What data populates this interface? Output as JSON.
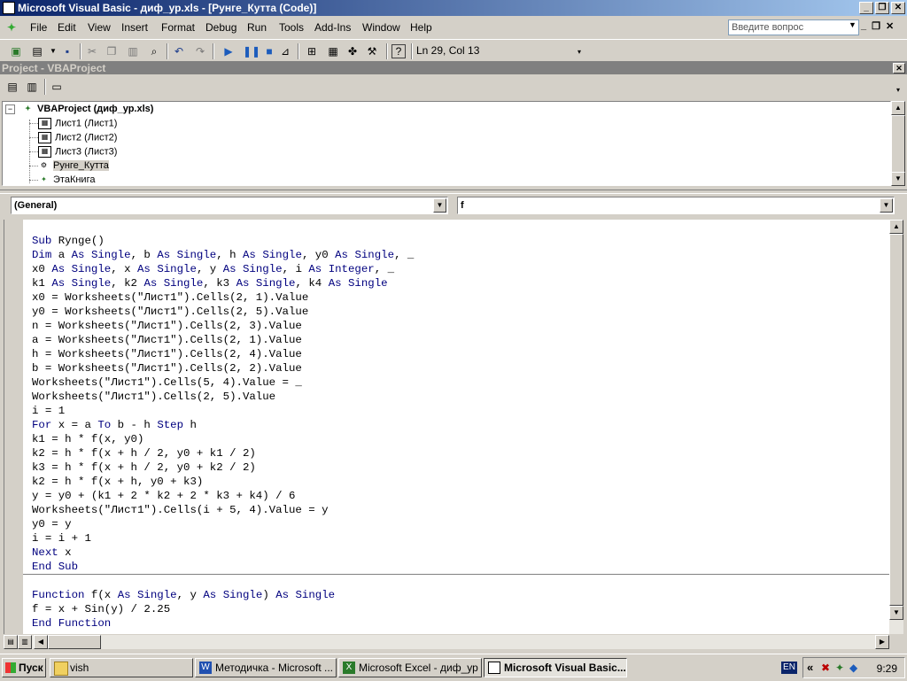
{
  "window": {
    "title": "Microsoft Visual Basic - диф_ур.xls - [Рунге_Кутта (Code)]",
    "buttons": [
      "_",
      "❐",
      "✕"
    ]
  },
  "menu": {
    "items": [
      "File",
      "Edit",
      "View",
      "Insert",
      "Format",
      "Debug",
      "Run",
      "Tools",
      "Add-Ins",
      "Window",
      "Help"
    ],
    "help_placeholder": "Введите вопрос",
    "mdi_buttons": [
      "_",
      "❐",
      "✕"
    ]
  },
  "toolbar": {
    "position": "Ln 29, Col 13"
  },
  "project": {
    "title": "Project - VBAProject",
    "close": "✕",
    "tree": {
      "root": "VBAProject (диф_ур.xls)",
      "items": [
        "Лист1 (Лист1)",
        "Лист2 (Лист2)",
        "Лист3 (Лист3)",
        "Рунге_Кутта",
        "ЭтаКнига"
      ]
    }
  },
  "editor": {
    "object_combo": "(General)",
    "proc_combo": "f",
    "code": [
      {
        "parts": [
          [
            "kw",
            "Sub"
          ],
          [
            "t",
            " Rynge()"
          ]
        ]
      },
      {
        "parts": [
          [
            "kw",
            "Dim"
          ],
          [
            "t",
            " a "
          ],
          [
            "kw",
            "As"
          ],
          [
            "t",
            " "
          ],
          [
            "kw",
            "Single"
          ],
          [
            "t",
            ", b "
          ],
          [
            "kw",
            "As"
          ],
          [
            "t",
            " "
          ],
          [
            "kw",
            "Single"
          ],
          [
            "t",
            ", h "
          ],
          [
            "kw",
            "As"
          ],
          [
            "t",
            " "
          ],
          [
            "kw",
            "Single"
          ],
          [
            "t",
            ", y0 "
          ],
          [
            "kw",
            "As"
          ],
          [
            "t",
            " "
          ],
          [
            "kw",
            "Single"
          ],
          [
            "t",
            ", _"
          ]
        ]
      },
      {
        "parts": [
          [
            "t",
            "x0 "
          ],
          [
            "kw",
            "As"
          ],
          [
            "t",
            " "
          ],
          [
            "kw",
            "Single"
          ],
          [
            "t",
            ", x "
          ],
          [
            "kw",
            "As"
          ],
          [
            "t",
            " "
          ],
          [
            "kw",
            "Single"
          ],
          [
            "t",
            ", y "
          ],
          [
            "kw",
            "As"
          ],
          [
            "t",
            " "
          ],
          [
            "kw",
            "Single"
          ],
          [
            "t",
            ", i "
          ],
          [
            "kw",
            "As"
          ],
          [
            "t",
            " "
          ],
          [
            "kw",
            "Integer"
          ],
          [
            "t",
            ", _"
          ]
        ]
      },
      {
        "parts": [
          [
            "t",
            "k1 "
          ],
          [
            "kw",
            "As"
          ],
          [
            "t",
            " "
          ],
          [
            "kw",
            "Single"
          ],
          [
            "t",
            ", k2 "
          ],
          [
            "kw",
            "As"
          ],
          [
            "t",
            " "
          ],
          [
            "kw",
            "Single"
          ],
          [
            "t",
            ", k3 "
          ],
          [
            "kw",
            "As"
          ],
          [
            "t",
            " "
          ],
          [
            "kw",
            "Single"
          ],
          [
            "t",
            ", k4 "
          ],
          [
            "kw",
            "As"
          ],
          [
            "t",
            " "
          ],
          [
            "kw",
            "Single"
          ]
        ]
      },
      {
        "parts": [
          [
            "t",
            "x0 = Worksheets(\"Лист1\").Cells(2, 1).Value"
          ]
        ]
      },
      {
        "parts": [
          [
            "t",
            "y0 = Worksheets(\"Лист1\").Cells(2, 5).Value"
          ]
        ]
      },
      {
        "parts": [
          [
            "t",
            "n = Worksheets(\"Лист1\").Cells(2, 3).Value"
          ]
        ]
      },
      {
        "parts": [
          [
            "t",
            "a = Worksheets(\"Лист1\").Cells(2, 1).Value"
          ]
        ]
      },
      {
        "parts": [
          [
            "t",
            "h = Worksheets(\"Лист1\").Cells(2, 4).Value"
          ]
        ]
      },
      {
        "parts": [
          [
            "t",
            "b = Worksheets(\"Лист1\").Cells(2, 2).Value"
          ]
        ]
      },
      {
        "parts": [
          [
            "t",
            "Worksheets(\"Лист1\").Cells(5, 4).Value = _"
          ]
        ]
      },
      {
        "parts": [
          [
            "t",
            "Worksheets(\"Лист1\").Cells(2, 5).Value"
          ]
        ]
      },
      {
        "parts": [
          [
            "t",
            "i = 1"
          ]
        ]
      },
      {
        "parts": [
          [
            "kw",
            "For"
          ],
          [
            "t",
            " x = a "
          ],
          [
            "kw",
            "To"
          ],
          [
            "t",
            " b - h "
          ],
          [
            "kw",
            "Step"
          ],
          [
            "t",
            " h"
          ]
        ]
      },
      {
        "parts": [
          [
            "t",
            "k1 = h * f(x, y0)"
          ]
        ]
      },
      {
        "parts": [
          [
            "t",
            "k2 = h * f(x + h / 2, y0 + k1 / 2)"
          ]
        ]
      },
      {
        "parts": [
          [
            "t",
            "k3 = h * f(x + h / 2, y0 + k2 / 2)"
          ]
        ]
      },
      {
        "parts": [
          [
            "t",
            "k2 = h * f(x + h, y0 + k3)"
          ]
        ]
      },
      {
        "parts": [
          [
            "t",
            "y = y0 + (k1 + 2 * k2 + 2 * k3 + k4) / 6"
          ]
        ]
      },
      {
        "parts": [
          [
            "t",
            "Worksheets(\"Лист1\").Cells(i + 5, 4).Value = y"
          ]
        ]
      },
      {
        "parts": [
          [
            "t",
            "y0 = y"
          ]
        ]
      },
      {
        "parts": [
          [
            "t",
            "i = i + 1"
          ]
        ]
      },
      {
        "parts": [
          [
            "kw",
            "Next"
          ],
          [
            "t",
            " x"
          ]
        ]
      },
      {
        "parts": [
          [
            "kw",
            "End Sub"
          ]
        ]
      }
    ],
    "code2": [
      {
        "parts": [
          [
            "kw",
            "Function"
          ],
          [
            "t",
            " f(x "
          ],
          [
            "kw",
            "As"
          ],
          [
            "t",
            " "
          ],
          [
            "kw",
            "Single"
          ],
          [
            "t",
            ", y "
          ],
          [
            "kw",
            "As"
          ],
          [
            "t",
            " "
          ],
          [
            "kw",
            "Single"
          ],
          [
            "t",
            ") "
          ],
          [
            "kw",
            "As"
          ],
          [
            "t",
            " "
          ],
          [
            "kw",
            "Single"
          ]
        ]
      },
      {
        "parts": [
          [
            "t",
            "f = x + Sin(y) / 2.25"
          ]
        ]
      },
      {
        "parts": [
          [
            "kw",
            "End Function"
          ]
        ]
      }
    ]
  },
  "taskbar": {
    "start": "Пуск",
    "tasks": [
      "vish",
      "Методичка - Microsoft ...",
      "Microsoft Excel - диф_ур",
      "Microsoft Visual Basic..."
    ],
    "lang": "EN",
    "chevron": "«",
    "clock": "9:29"
  }
}
